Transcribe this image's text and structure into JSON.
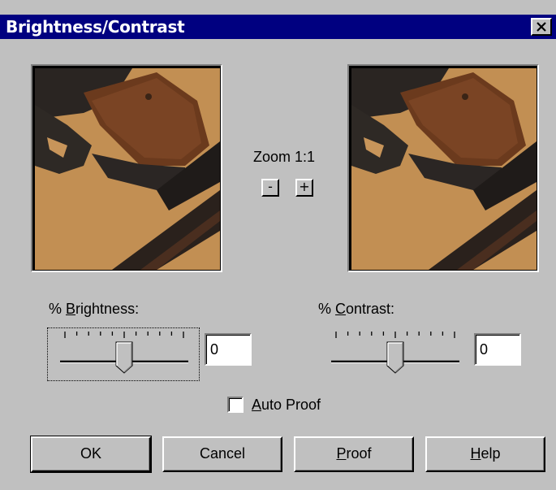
{
  "window": {
    "title": "Brightness/Contrast",
    "close_icon": "close-x-icon"
  },
  "preview": {
    "left_image": "original-preview-pistol-grip",
    "right_image": "proof-preview-pistol-grip",
    "zoom_label": "Zoom 1:1",
    "zoom_out_label": "-",
    "zoom_in_label": "+"
  },
  "brightness": {
    "label_prefix": "% ",
    "label_accel": "B",
    "label_rest": "rightness:",
    "value": "0",
    "slider_position": 0.5
  },
  "contrast": {
    "label_prefix": "% ",
    "label_accel": "C",
    "label_rest": "ontrast:",
    "value": "0",
    "slider_position": 0.5
  },
  "auto_proof": {
    "accel": "A",
    "rest": "uto Proof",
    "checked": false
  },
  "buttons": {
    "ok": "OK",
    "cancel": "Cancel",
    "proof_accel": "P",
    "proof_rest": "roof",
    "help_accel": "H",
    "help_rest": "elp"
  },
  "colors": {
    "titlebar": "#000080",
    "face": "#c0c0c0"
  }
}
